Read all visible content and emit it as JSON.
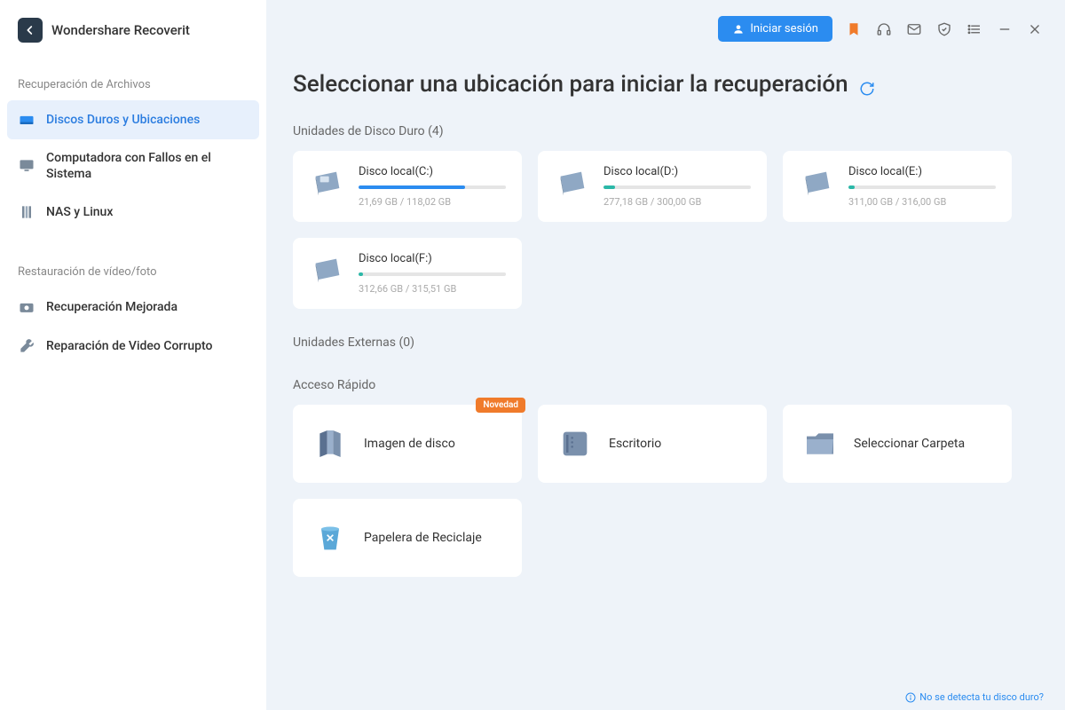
{
  "app": {
    "title": "Wondershare Recoverit"
  },
  "header": {
    "login_label": "Iniciar sesión"
  },
  "sidebar": {
    "section1_label": "Recuperación de Archivos",
    "items1": [
      {
        "label": "Discos Duros y Ubicaciones"
      },
      {
        "label": "Computadora con Fallos en el Sistema"
      },
      {
        "label": "NAS y Linux"
      }
    ],
    "section2_label": "Restauración de vídeo/foto",
    "items2": [
      {
        "label": "Recuperación Mejorada"
      },
      {
        "label": "Reparación de Video Corrupto"
      }
    ]
  },
  "main": {
    "title": "Seleccionar una ubicación para iniciar la recuperación",
    "hdd_section": "Unidades de Disco Duro (4)",
    "ext_section": "Unidades Externas (0)",
    "quick_section": "Acceso Rápido",
    "disks": [
      {
        "name": "Disco local(C:)",
        "size": "21,69 GB / 118,02 GB",
        "pct": 72,
        "color": "#2b8cf0"
      },
      {
        "name": "Disco local(D:)",
        "size": "277,18 GB / 300,00 GB",
        "pct": 8,
        "color": "#2bb8a8"
      },
      {
        "name": "Disco local(E:)",
        "size": "311,00 GB / 316,00 GB",
        "pct": 4,
        "color": "#2bb8a8"
      },
      {
        "name": "Disco local(F:)",
        "size": "312,66 GB / 315,51 GB",
        "pct": 3,
        "color": "#2bb8a8"
      }
    ],
    "quick": [
      {
        "label": "Imagen de disco",
        "badge": "Novedad"
      },
      {
        "label": "Escritorio"
      },
      {
        "label": "Seleccionar Carpeta"
      },
      {
        "label": "Papelera de Reciclaje"
      }
    ],
    "footer_link": "No se detecta tu disco duro?"
  }
}
